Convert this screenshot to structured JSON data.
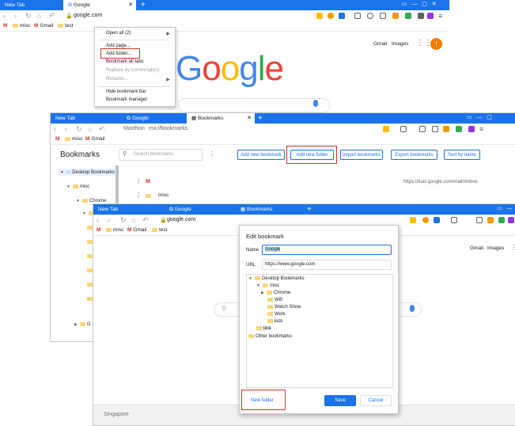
{
  "win1": {
    "tabs": [
      "New Tab",
      "Google"
    ],
    "url": "google.com",
    "bookmarks": [
      "misc",
      "Gmail",
      "test"
    ],
    "gmail": "Gmail",
    "images": "Images",
    "avatar": "!",
    "google_letters": [
      "G",
      "o",
      "o",
      "g",
      "l",
      "e"
    ],
    "google_colors": [
      "#4285f4",
      "#ea4335",
      "#fbbc05",
      "#4285f4",
      "#34a853",
      "#ea4335"
    ],
    "context_menu": [
      "Open all (2)",
      "Add page...",
      "Add folder...",
      "Bookmark all tabs",
      "Replace by current tab(s)",
      "Rename...",
      "Hide bookmark bar",
      "Bookmark manager"
    ]
  },
  "win2": {
    "tabs": [
      "New Tab",
      "Google",
      "Bookmarks"
    ],
    "browser": "Maxthon",
    "url": "mx://bookmarks",
    "bookmarks": [
      "misc",
      "Gmail"
    ],
    "title": "Bookmarks",
    "search_placeholder": "Search bookmarks",
    "buttons": [
      "Add new bookmark",
      "Add new folder",
      "Import bookmarks",
      "Export bookmarks",
      "Sort by name"
    ],
    "tree": [
      "Desktop Bookmarks",
      "misc",
      "Chrome",
      "B",
      "G"
    ],
    "rows": [
      {
        "icon": "M",
        "name": "",
        "url": "https://mail.google.com/mail/#inbox"
      },
      {
        "icon": "folder",
        "name": "misc",
        "url": ""
      }
    ]
  },
  "win3": {
    "tabs": [
      "New Tab",
      "Google",
      "Bookmarks"
    ],
    "url": "google.com",
    "bookmarks": [
      "misc",
      "Gmail",
      "test"
    ],
    "gmail": "Gmail",
    "images": "Images",
    "footer": "Singapore",
    "dialog": {
      "title": "Edit bookmark",
      "name_label": "Name",
      "name_value": "Google",
      "url_label": "URL",
      "url_value": "https://www.google.com",
      "tree": [
        "Desktop Bookmarks",
        "misc",
        "Chrome",
        "Wifi",
        "Watch Show",
        "Work",
        "kids",
        "test",
        "Other bookmarks"
      ],
      "new_folder": "New folder",
      "save": "Save",
      "cancel": "Cancel"
    }
  },
  "colors": {
    "accent": "#1a73e8",
    "red": "#d93025",
    "folder": "#f7d675"
  }
}
